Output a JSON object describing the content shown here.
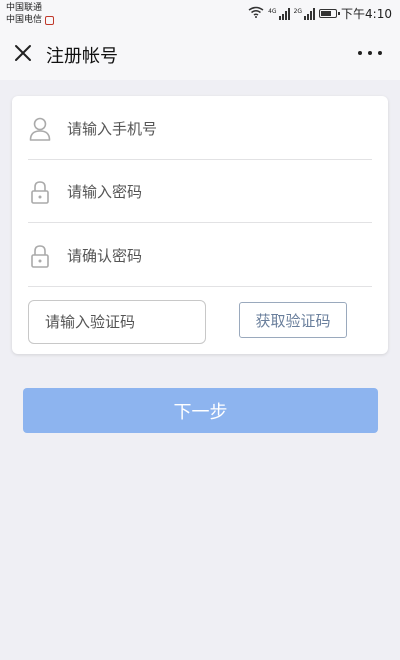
{
  "status_bar": {
    "carrier1": "中国联通",
    "carrier2": "中国电信",
    "net1": "4G",
    "net2": "2G",
    "time": "下午4:10",
    "battery_level": 0.8
  },
  "header": {
    "title": "注册帐号",
    "close_icon": "close-icon",
    "more_icon": "more-icon"
  },
  "form": {
    "phone_placeholder": "请输入手机号",
    "password_placeholder": "请输入密码",
    "confirm_placeholder": "请确认密码",
    "code_placeholder": "请输入验证码",
    "get_code_label": "获取验证码"
  },
  "next_label": "下一步",
  "colors": {
    "primary_button": "#8db4ef",
    "code_button_text": "#6a7f9c",
    "background": "#efeff4"
  }
}
